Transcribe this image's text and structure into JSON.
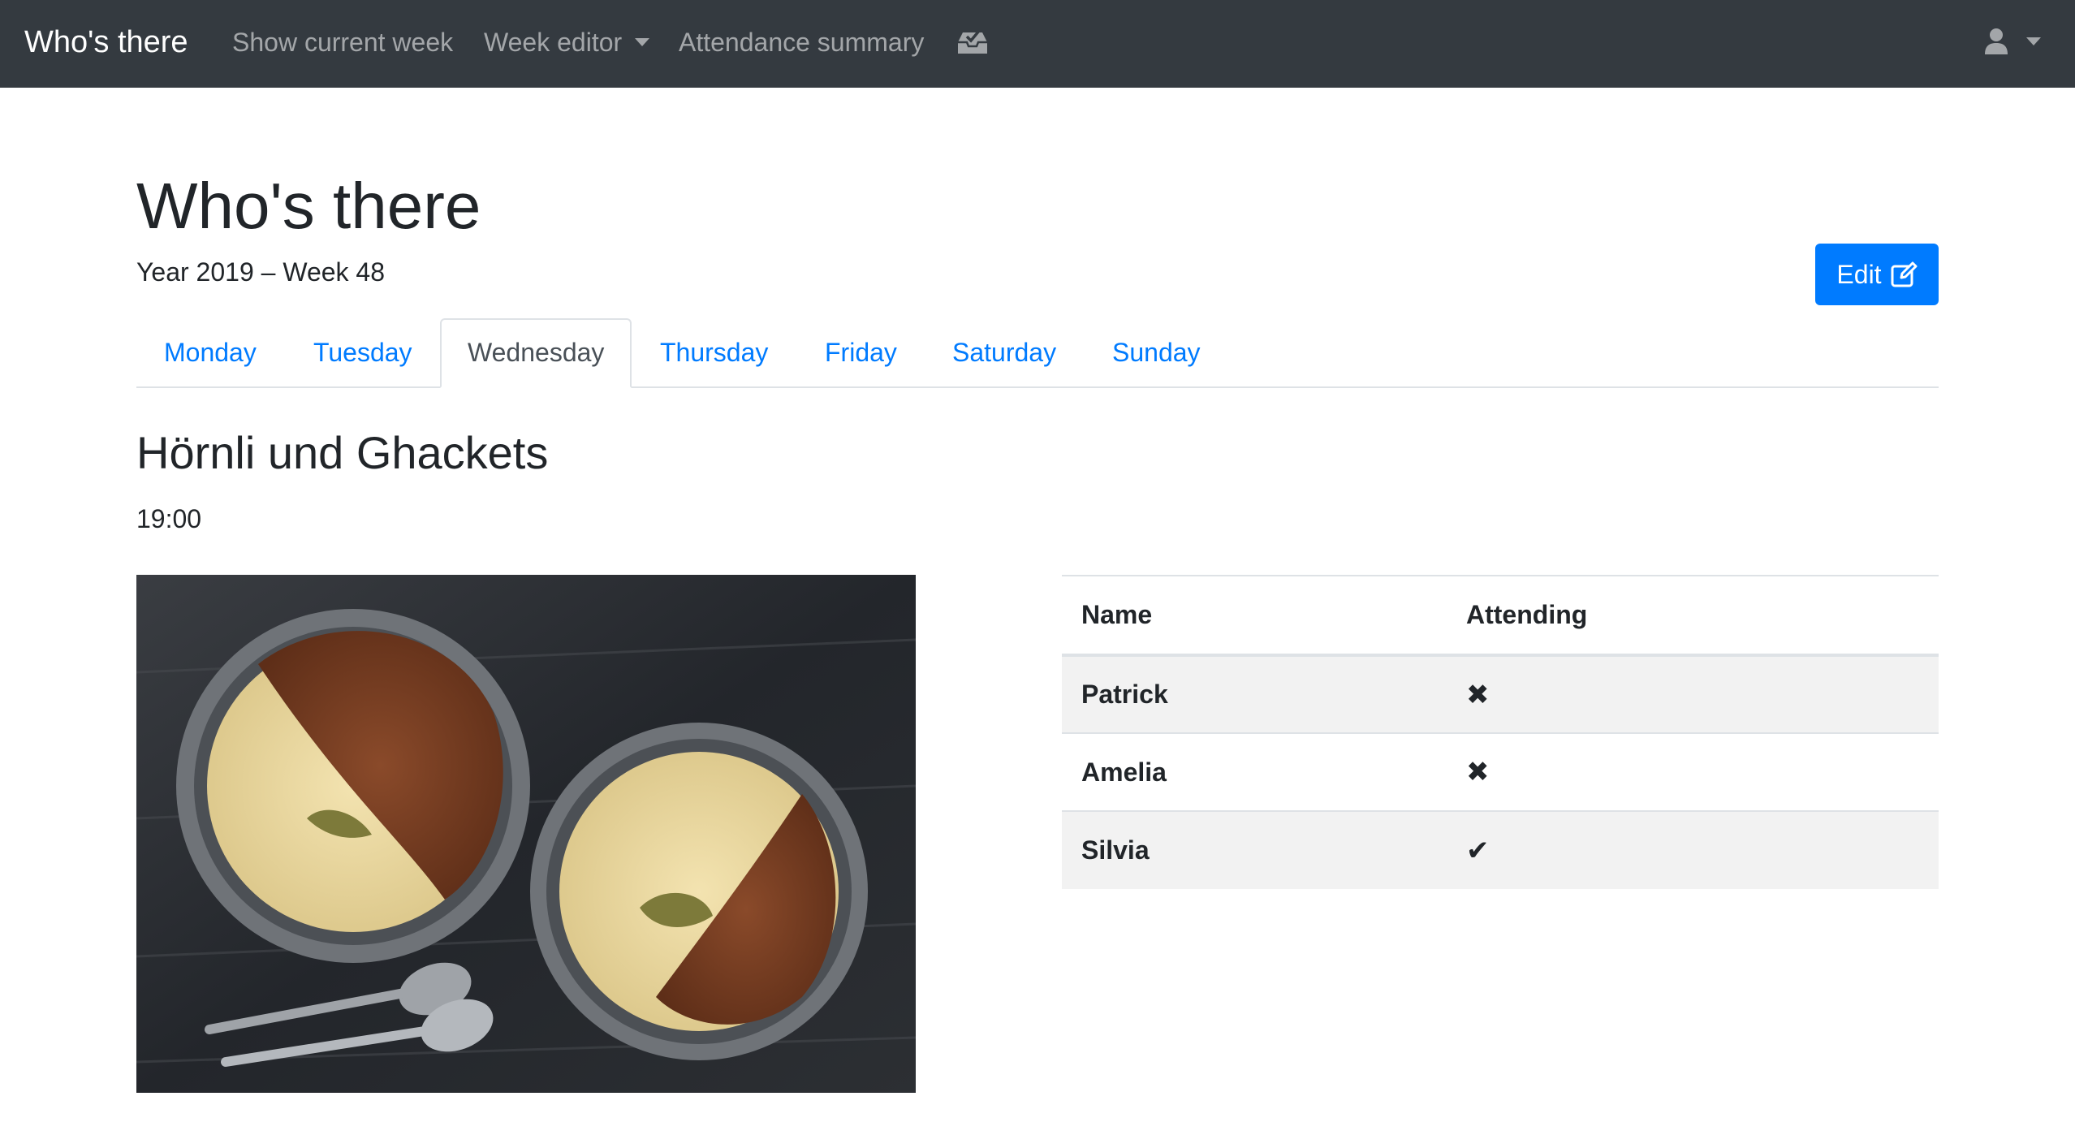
{
  "navbar": {
    "brand": "Who's there",
    "links": {
      "current_week": "Show current week",
      "week_editor": "Week editor",
      "attendance_summary": "Attendance summary"
    },
    "inbox_icon": "inbox-check-icon",
    "user_icon": "user-icon"
  },
  "header": {
    "title": "Who's there",
    "subtitle": "Year 2019 – Week 48",
    "edit_label": "Edit"
  },
  "tabs": [
    {
      "label": "Monday"
    },
    {
      "label": "Tuesday"
    },
    {
      "label": "Wednesday",
      "active": true
    },
    {
      "label": "Thursday"
    },
    {
      "label": "Friday"
    },
    {
      "label": "Saturday"
    },
    {
      "label": "Sunday"
    }
  ],
  "meal": {
    "title": "Hörnli und Ghackets",
    "time": "19:00"
  },
  "attendance": {
    "headers": [
      "Name",
      "Attending"
    ],
    "rows": [
      {
        "name": "Patrick",
        "attending": "✖",
        "status": false
      },
      {
        "name": "Amelia",
        "attending": "✖",
        "status": false
      },
      {
        "name": "Silvia",
        "attending": "✔",
        "status": true
      }
    ]
  },
  "colors": {
    "navbar_bg": "#343a40",
    "primary": "#007bff",
    "stripe": "#f2f2f2"
  }
}
